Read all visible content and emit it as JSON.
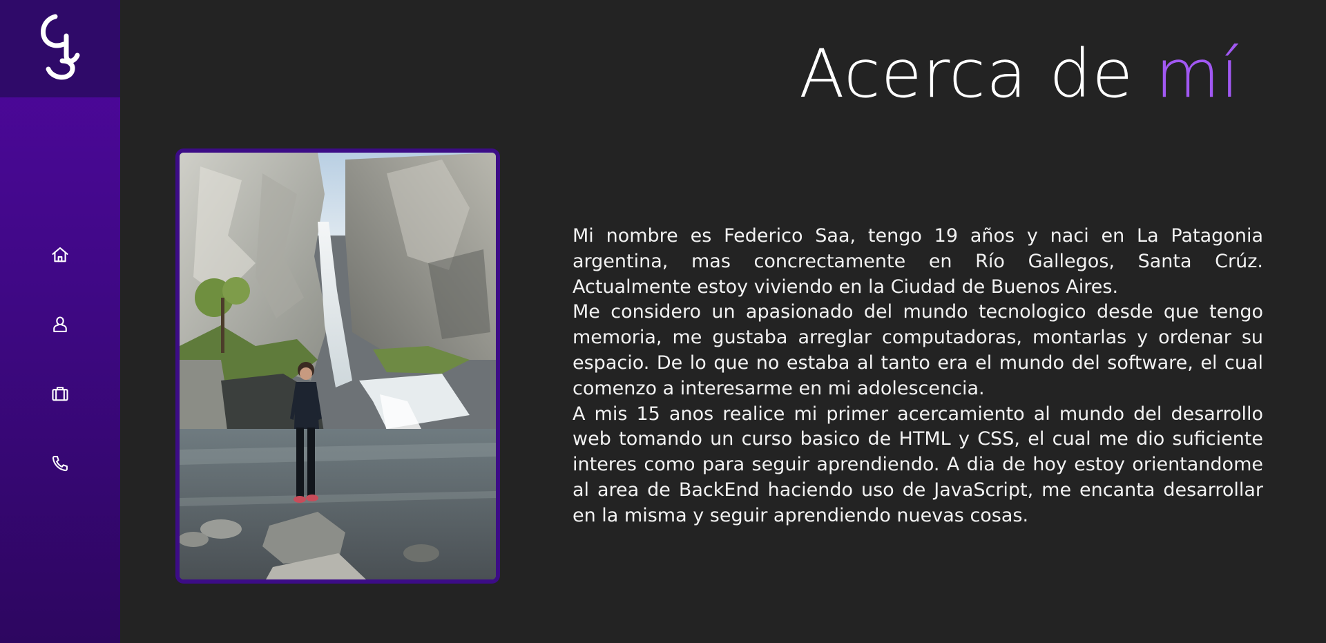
{
  "brand": {
    "logo_icon": "fs-monogram-logo"
  },
  "sidebar": {
    "items": [
      {
        "icon": "home-icon",
        "name": "home"
      },
      {
        "icon": "user-icon",
        "name": "about"
      },
      {
        "icon": "briefcase-icon",
        "name": "portfolio"
      },
      {
        "icon": "phone-icon",
        "name": "contact"
      }
    ]
  },
  "header": {
    "title_main": "Acerca de ",
    "title_accent": "mí"
  },
  "photo": {
    "description": "waterfall-portrait",
    "frame_color": "#3c0c86"
  },
  "bio": {
    "paragraphs": [
      "Mi nombre es Federico Saa, tengo 19 años y naci en La Patagonia argentina, mas concrectamente en Río Gallegos, Santa Crúz. Actualmente estoy viviendo en la Ciudad de Buenos Aires.",
      "Me considero un apasionado del mundo tecnologico desde que tengo memoria, me gustaba arreglar computadoras, montarlas y ordenar su espacio. De lo que no estaba al tanto era el mundo del software, el cual comenzo a interesarme en mi adolescencia.",
      "A mis 15 anos realice mi primer acercamiento al mundo del desarrollo web tomando un curso basico de HTML y CSS, el cual me dio suficiente interes como para seguir aprendiendo. A dia de hoy estoy orientandome al area de BackEnd haciendo uso de JavaScript, me encanta desarrollar en la misma y seguir aprendiendo nuevas cosas."
    ]
  },
  "colors": {
    "background": "#232323",
    "sidebar": "#4b079a",
    "logo_box": "#2f0a69",
    "accent": "#a158f2",
    "text": "#f2f2f2"
  }
}
